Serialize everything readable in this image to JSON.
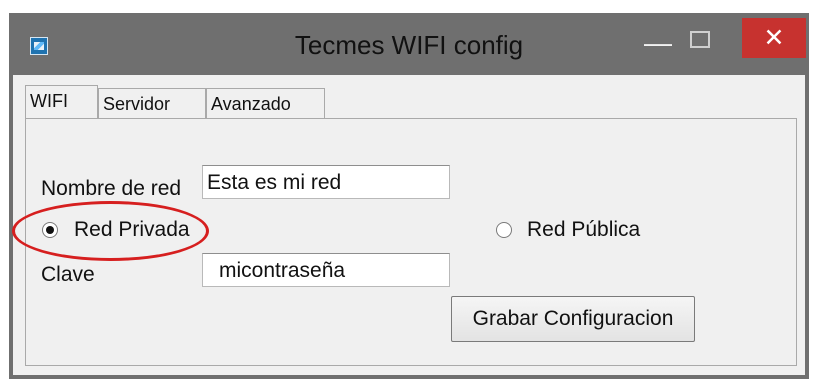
{
  "window": {
    "title": "Tecmes WIFI config",
    "controls": {
      "minimize": "—",
      "maximize": "",
      "close": "✕"
    }
  },
  "tabs": [
    {
      "label": "WIFI",
      "active": true
    },
    {
      "label": "Servidor",
      "active": false
    },
    {
      "label": "Avanzado",
      "active": false
    }
  ],
  "form": {
    "network_name_label": "Nombre de red",
    "network_name_value": "Esta es mi red",
    "radio_private_label": "Red Privada",
    "radio_public_label": "Red Pública",
    "selected_radio": "Red Privada",
    "password_label": "Clave",
    "password_value": "micontraseña",
    "save_button_label": "Grabar Configuracion"
  },
  "colors": {
    "titlebar": "#6f6f6f",
    "close_button": "#c7322f",
    "annotation": "#d61f1f",
    "client_background": "#f0f0f0"
  },
  "icons": {
    "app": "app-icon",
    "minimize": "minimize-icon",
    "maximize": "maximize-icon",
    "close": "close-icon"
  }
}
